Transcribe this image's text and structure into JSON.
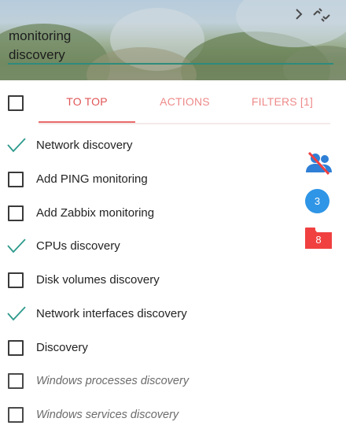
{
  "search": {
    "value": "monitoring\ndiscovery"
  },
  "colors": {
    "accent_tab": "#e05555",
    "tab_inactive": "#ee8a8a",
    "check": "#2e9a8c",
    "search_underline": "#2e8b7d",
    "badge_blue": "#2f95e6",
    "badge_red": "#f04040"
  },
  "icons": {
    "header_right": [
      "chevron-right-icon",
      "unlink-icon"
    ],
    "side": [
      "users-off-icon",
      "folder-icon"
    ]
  },
  "toolbar": {
    "tabs": [
      {
        "label": "TO TOP",
        "active": true
      },
      {
        "label": "ACTIONS",
        "active": false
      },
      {
        "label": "FILTERS [1]",
        "active": false
      }
    ]
  },
  "tasks": [
    {
      "label": "Network discovery",
      "checked": true,
      "disabled": false
    },
    {
      "label": "Add PING monitoring",
      "checked": false,
      "disabled": false
    },
    {
      "label": "Add Zabbix monitoring",
      "checked": false,
      "disabled": false
    },
    {
      "label": "CPUs discovery",
      "checked": true,
      "disabled": false
    },
    {
      "label": "Disk volumes discovery",
      "checked": false,
      "disabled": false
    },
    {
      "label": "Network interfaces discovery",
      "checked": true,
      "disabled": false
    },
    {
      "label": "Discovery",
      "checked": false,
      "disabled": false
    },
    {
      "label": "Windows processes discovery",
      "checked": false,
      "disabled": true
    },
    {
      "label": "Windows services discovery",
      "checked": false,
      "disabled": true
    }
  ],
  "side": {
    "count_badge": "3",
    "folder_badge": "8"
  }
}
